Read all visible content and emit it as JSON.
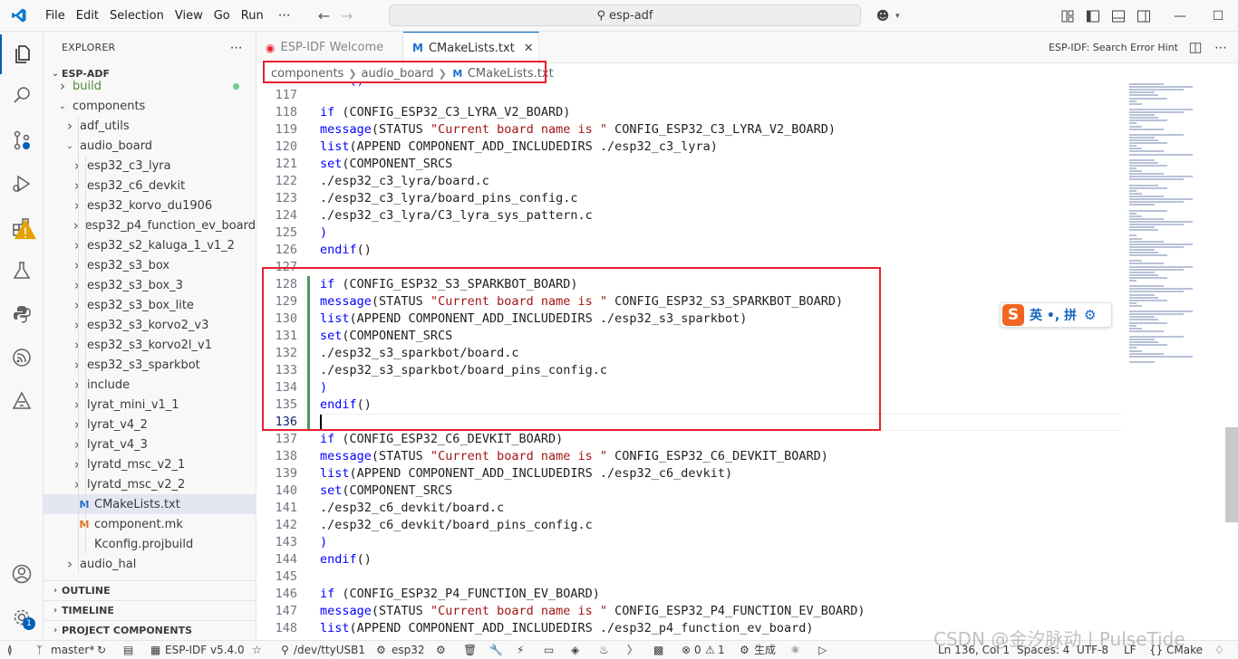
{
  "titlebar": {
    "menu": [
      "File",
      "Edit",
      "Selection",
      "View",
      "Go",
      "Run"
    ],
    "more": "⋯",
    "search_text": "esp-adf"
  },
  "explorer": {
    "header": "EXPLORER",
    "root": "ESP-ADF",
    "tree": [
      {
        "label": "build",
        "depth": 1,
        "kind": "folder-closed",
        "status": "green"
      },
      {
        "label": "components",
        "depth": 1,
        "kind": "folder-open"
      },
      {
        "label": "adf_utils",
        "depth": 2,
        "kind": "folder-closed"
      },
      {
        "label": "audio_board",
        "depth": 2,
        "kind": "folder-open"
      },
      {
        "label": "esp32_c3_lyra",
        "depth": 3,
        "kind": "folder-closed"
      },
      {
        "label": "esp32_c6_devkit",
        "depth": 3,
        "kind": "folder-closed"
      },
      {
        "label": "esp32_korvo_du1906",
        "depth": 3,
        "kind": "folder-closed"
      },
      {
        "label": "esp32_p4_function_ev_board",
        "depth": 3,
        "kind": "folder-closed"
      },
      {
        "label": "esp32_s2_kaluga_1_v1_2",
        "depth": 3,
        "kind": "folder-closed"
      },
      {
        "label": "esp32_s3_box",
        "depth": 3,
        "kind": "folder-closed"
      },
      {
        "label": "esp32_s3_box_3",
        "depth": 3,
        "kind": "folder-closed"
      },
      {
        "label": "esp32_s3_box_lite",
        "depth": 3,
        "kind": "folder-closed"
      },
      {
        "label": "esp32_s3_korvo2_v3",
        "depth": 3,
        "kind": "folder-closed"
      },
      {
        "label": "esp32_s3_korvo2l_v1",
        "depth": 3,
        "kind": "folder-closed"
      },
      {
        "label": "esp32_s3_sparkbot",
        "depth": 3,
        "kind": "folder-closed"
      },
      {
        "label": "include",
        "depth": 3,
        "kind": "folder-closed"
      },
      {
        "label": "lyrat_mini_v1_1",
        "depth": 3,
        "kind": "folder-closed"
      },
      {
        "label": "lyrat_v4_2",
        "depth": 3,
        "kind": "folder-closed"
      },
      {
        "label": "lyrat_v4_3",
        "depth": 3,
        "kind": "folder-closed"
      },
      {
        "label": "lyratd_msc_v2_1",
        "depth": 3,
        "kind": "folder-closed"
      },
      {
        "label": "lyratd_msc_v2_2",
        "depth": 3,
        "kind": "folder-closed"
      },
      {
        "label": "CMakeLists.txt",
        "depth": 3,
        "kind": "file-cmake",
        "selected": true
      },
      {
        "label": "component.mk",
        "depth": 3,
        "kind": "file-mk"
      },
      {
        "label": "Kconfig.projbuild",
        "depth": 3,
        "kind": "file-plain"
      },
      {
        "label": "audio_hal",
        "depth": 2,
        "kind": "folder-closed"
      }
    ],
    "outline": "OUTLINE",
    "timeline": "TIMELINE",
    "project_components": "PROJECT COMPONENTS"
  },
  "tabs": {
    "welcome": "ESP-IDF Welcome",
    "cmake": "CMakeLists.txt",
    "close_glyph": "✕",
    "right_action": "ESP-IDF: Search Error Hint"
  },
  "breadcrumb": [
    "components",
    "audio_board",
    "CMakeLists.txt"
  ],
  "editor": {
    "top_partial": "    ()",
    "lines": [
      {
        "n": "117",
        "tokens": []
      },
      {
        "n": "118",
        "tokens": [
          [
            "kw",
            "if"
          ],
          [
            "t",
            " (CONFIG_ESP32_C3_LYRA_V2_BOARD)"
          ]
        ]
      },
      {
        "n": "119",
        "tokens": [
          [
            "kw",
            "message"
          ],
          [
            "t",
            "(STATUS "
          ],
          [
            "str",
            "\"Current board name is \""
          ],
          [
            "t",
            " CONFIG_ESP32_C3_LYRA_V2_BOARD)"
          ]
        ]
      },
      {
        "n": "120",
        "tokens": [
          [
            "kw",
            "list"
          ],
          [
            "t",
            "(APPEND COMPONENT_ADD_INCLUDEDIRS ./esp32_c3_lyra)"
          ]
        ]
      },
      {
        "n": "121",
        "tokens": [
          [
            "kw",
            "set"
          ],
          [
            "t",
            "(COMPONENT_SRCS"
          ]
        ]
      },
      {
        "n": "122",
        "tokens": [
          [
            "t",
            "./esp32_c3_lyra/board.c"
          ]
        ]
      },
      {
        "n": "123",
        "tokens": [
          [
            "t",
            "./esp32_c3_lyra/board_pins_config.c"
          ]
        ]
      },
      {
        "n": "124",
        "tokens": [
          [
            "t",
            "./esp32_c3_lyra/C3_lyra_sys_pattern.c"
          ]
        ]
      },
      {
        "n": "125",
        "tokens": [
          [
            "kw",
            ")"
          ]
        ]
      },
      {
        "n": "126",
        "tokens": [
          [
            "kw",
            "endif"
          ],
          [
            "t",
            "()"
          ]
        ]
      },
      {
        "n": "127",
        "tokens": []
      },
      {
        "n": "128",
        "tokens": [
          [
            "kw",
            "if"
          ],
          [
            "t",
            " (CONFIG_ESP32_S3_SPARKBOT_BOARD)"
          ]
        ],
        "mod": true
      },
      {
        "n": "129",
        "tokens": [
          [
            "kw",
            "message"
          ],
          [
            "t",
            "(STATUS "
          ],
          [
            "str",
            "\"Current board name is \""
          ],
          [
            "t",
            " CONFIG_ESP32_S3_SPARKBOT_BOARD)"
          ]
        ],
        "mod": true
      },
      {
        "n": "130",
        "tokens": [
          [
            "kw",
            "list"
          ],
          [
            "t",
            "(APPEND COMPONENT_ADD_INCLUDEDIRS ./esp32_s3_sparkbot)"
          ]
        ],
        "mod": true
      },
      {
        "n": "131",
        "tokens": [
          [
            "kw",
            "set"
          ],
          [
            "t",
            "(COMPONENT_SRCS"
          ]
        ],
        "mod": true
      },
      {
        "n": "132",
        "tokens": [
          [
            "t",
            "./esp32_s3_sparkbot/board.c"
          ]
        ],
        "mod": true
      },
      {
        "n": "133",
        "tokens": [
          [
            "t",
            "./esp32_s3_sparkbot/board_pins_config.c"
          ]
        ],
        "mod": true
      },
      {
        "n": "134",
        "tokens": [
          [
            "kw",
            ")"
          ]
        ],
        "mod": true
      },
      {
        "n": "135",
        "tokens": [
          [
            "kw",
            "endif"
          ],
          [
            "t",
            "()"
          ]
        ],
        "mod": true
      },
      {
        "n": "136",
        "tokens": [],
        "mod": true,
        "current": true
      },
      {
        "n": "137",
        "tokens": [
          [
            "kw",
            "if"
          ],
          [
            "t",
            " (CONFIG_ESP32_C6_DEVKIT_BOARD)"
          ]
        ]
      },
      {
        "n": "138",
        "tokens": [
          [
            "kw",
            "message"
          ],
          [
            "t",
            "(STATUS "
          ],
          [
            "str",
            "\"Current board name is \""
          ],
          [
            "t",
            " CONFIG_ESP32_C6_DEVKIT_BOARD)"
          ]
        ]
      },
      {
        "n": "139",
        "tokens": [
          [
            "kw",
            "list"
          ],
          [
            "t",
            "(APPEND COMPONENT_ADD_INCLUDEDIRS ./esp32_c6_devkit)"
          ]
        ]
      },
      {
        "n": "140",
        "tokens": [
          [
            "kw",
            "set"
          ],
          [
            "t",
            "(COMPONENT_SRCS"
          ]
        ]
      },
      {
        "n": "141",
        "tokens": [
          [
            "t",
            "./esp32_c6_devkit/board.c"
          ]
        ]
      },
      {
        "n": "142",
        "tokens": [
          [
            "t",
            "./esp32_c6_devkit/board_pins_config.c"
          ]
        ]
      },
      {
        "n": "143",
        "tokens": [
          [
            "kw",
            ")"
          ]
        ]
      },
      {
        "n": "144",
        "tokens": [
          [
            "kw",
            "endif"
          ],
          [
            "t",
            "()"
          ]
        ]
      },
      {
        "n": "145",
        "tokens": []
      },
      {
        "n": "146",
        "tokens": [
          [
            "kw",
            "if"
          ],
          [
            "t",
            " (CONFIG_ESP32_P4_FUNCTION_EV_BOARD)"
          ]
        ]
      },
      {
        "n": "147",
        "tokens": [
          [
            "kw",
            "message"
          ],
          [
            "t",
            "(STATUS "
          ],
          [
            "str",
            "\"Current board name is \""
          ],
          [
            "t",
            " CONFIG_ESP32_P4_FUNCTION_EV_BOARD)"
          ]
        ]
      },
      {
        "n": "148",
        "tokens": [
          [
            "kw",
            "list"
          ],
          [
            "t",
            "(APPEND COMPONENT_ADD_INCLUDEDIRS ./esp32_p4_function_ev_board)"
          ]
        ]
      }
    ]
  },
  "ime": {
    "logo": "S",
    "text": "英 •, 拼"
  },
  "statusbar": {
    "branch": "master*",
    "idf_version": "ESP-IDF v5.4.0",
    "port": "/dev/ttyUSB1",
    "target": "esp32",
    "problems_errors": "0",
    "problems_warnings": "1",
    "build_label": "生成",
    "cursor": "Ln 136, Col 1",
    "spaces": "Spaces: 4",
    "encoding": "UTF-8",
    "eol": "LF",
    "language": "CMake"
  },
  "watermark": "CSDN @金汐脉动 | PulseTide",
  "colors": {
    "accent": "#005fb8",
    "highlight_box": "#e8202f",
    "keyword": "#0000ff",
    "string": "#a31515",
    "modified_gutter": "#48985d"
  }
}
